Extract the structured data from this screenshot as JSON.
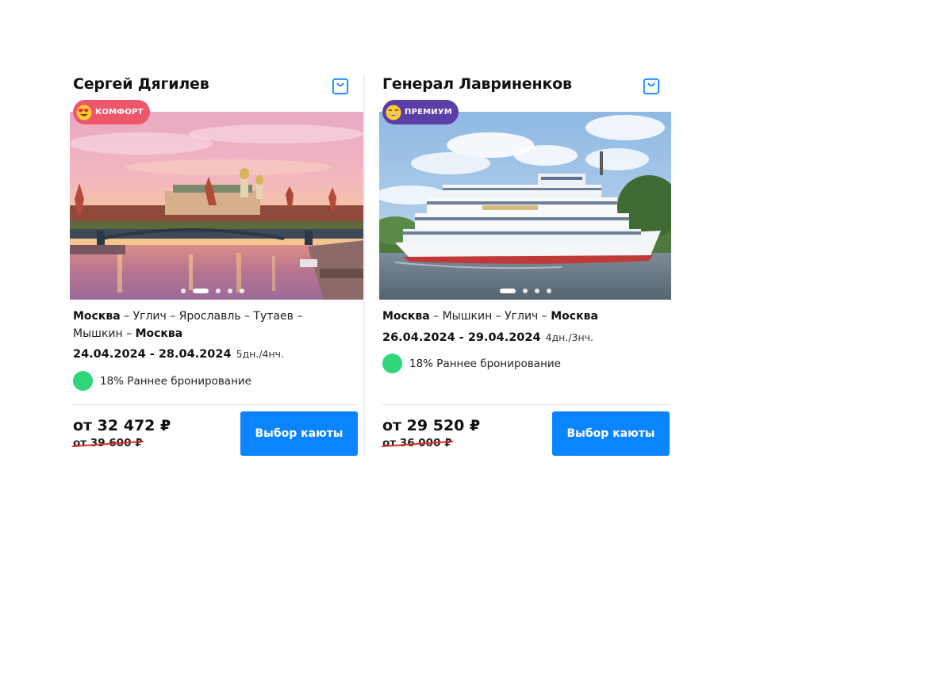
{
  "cards": [
    {
      "ship_name": "Сергей Дягилев",
      "class_badge": "КОМФОРТ",
      "class_color": "#f0566a",
      "photo_subject": "moscow-kremlin-sunset",
      "route": {
        "start": "Москва",
        "middle": " – Углич – Ярославль – Тутаев – Мышкин – ",
        "end": "Москва"
      },
      "dates": "24.04.2024 - 28.04.2024",
      "duration": "5дн./4нч.",
      "promo": "18% Раннее бронирование",
      "price": "от 32 472 ₽",
      "old_price": "от 39 600 ₽",
      "button_label": "Выбор каюты",
      "photo_slides": 5,
      "active_slide": 2
    },
    {
      "ship_name": "Генерал Лавриненков",
      "class_badge": "ПРЕМИУМ",
      "class_color": "#5b3ea6",
      "photo_subject": "river-cruise-ship",
      "route": {
        "start": "Москва",
        "middle": " – Мышкин – Углич – ",
        "end": "Москва"
      },
      "dates": "26.04.2024 - 29.04.2024",
      "duration": "4дн./3нч.",
      "promo": "18% Раннее бронирование",
      "price": "от 29 520 ₽",
      "old_price": "от 36 000 ₽",
      "button_label": "Выбор каюты",
      "photo_slides": 4,
      "active_slide": 1
    }
  ],
  "colors": {
    "accent_button": "#0a84ff",
    "promo_green": "#2fd67a",
    "strike_red": "#e0302a"
  },
  "icons": {
    "favorite": "shopping-bag-icon",
    "badge_comfort": "heart-eyes-emoji-icon",
    "badge_premium": "grinning-emoji-icon"
  }
}
